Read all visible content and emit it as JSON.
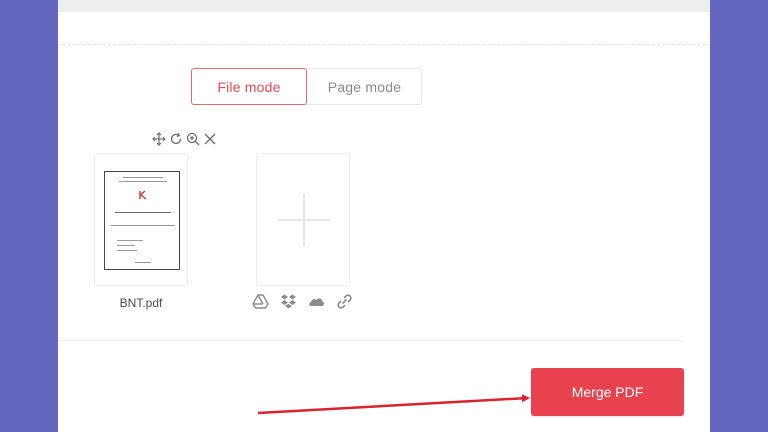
{
  "mode_toggle": {
    "file_mode_label": "File mode",
    "page_mode_label": "Page mode",
    "selected": "file"
  },
  "file_tools": [
    "move-icon",
    "rotate-icon",
    "zoom-in-icon",
    "close-icon"
  ],
  "files": [
    {
      "name": "BNT.pdf"
    }
  ],
  "upload_sources": [
    "google-drive-icon",
    "dropbox-icon",
    "onedrive-icon",
    "link-icon"
  ],
  "actions": {
    "merge_label": "Merge PDF"
  },
  "colors": {
    "background": "#6367bd",
    "accent": "#e8424f",
    "annotation_arrow": "#d9232e"
  }
}
